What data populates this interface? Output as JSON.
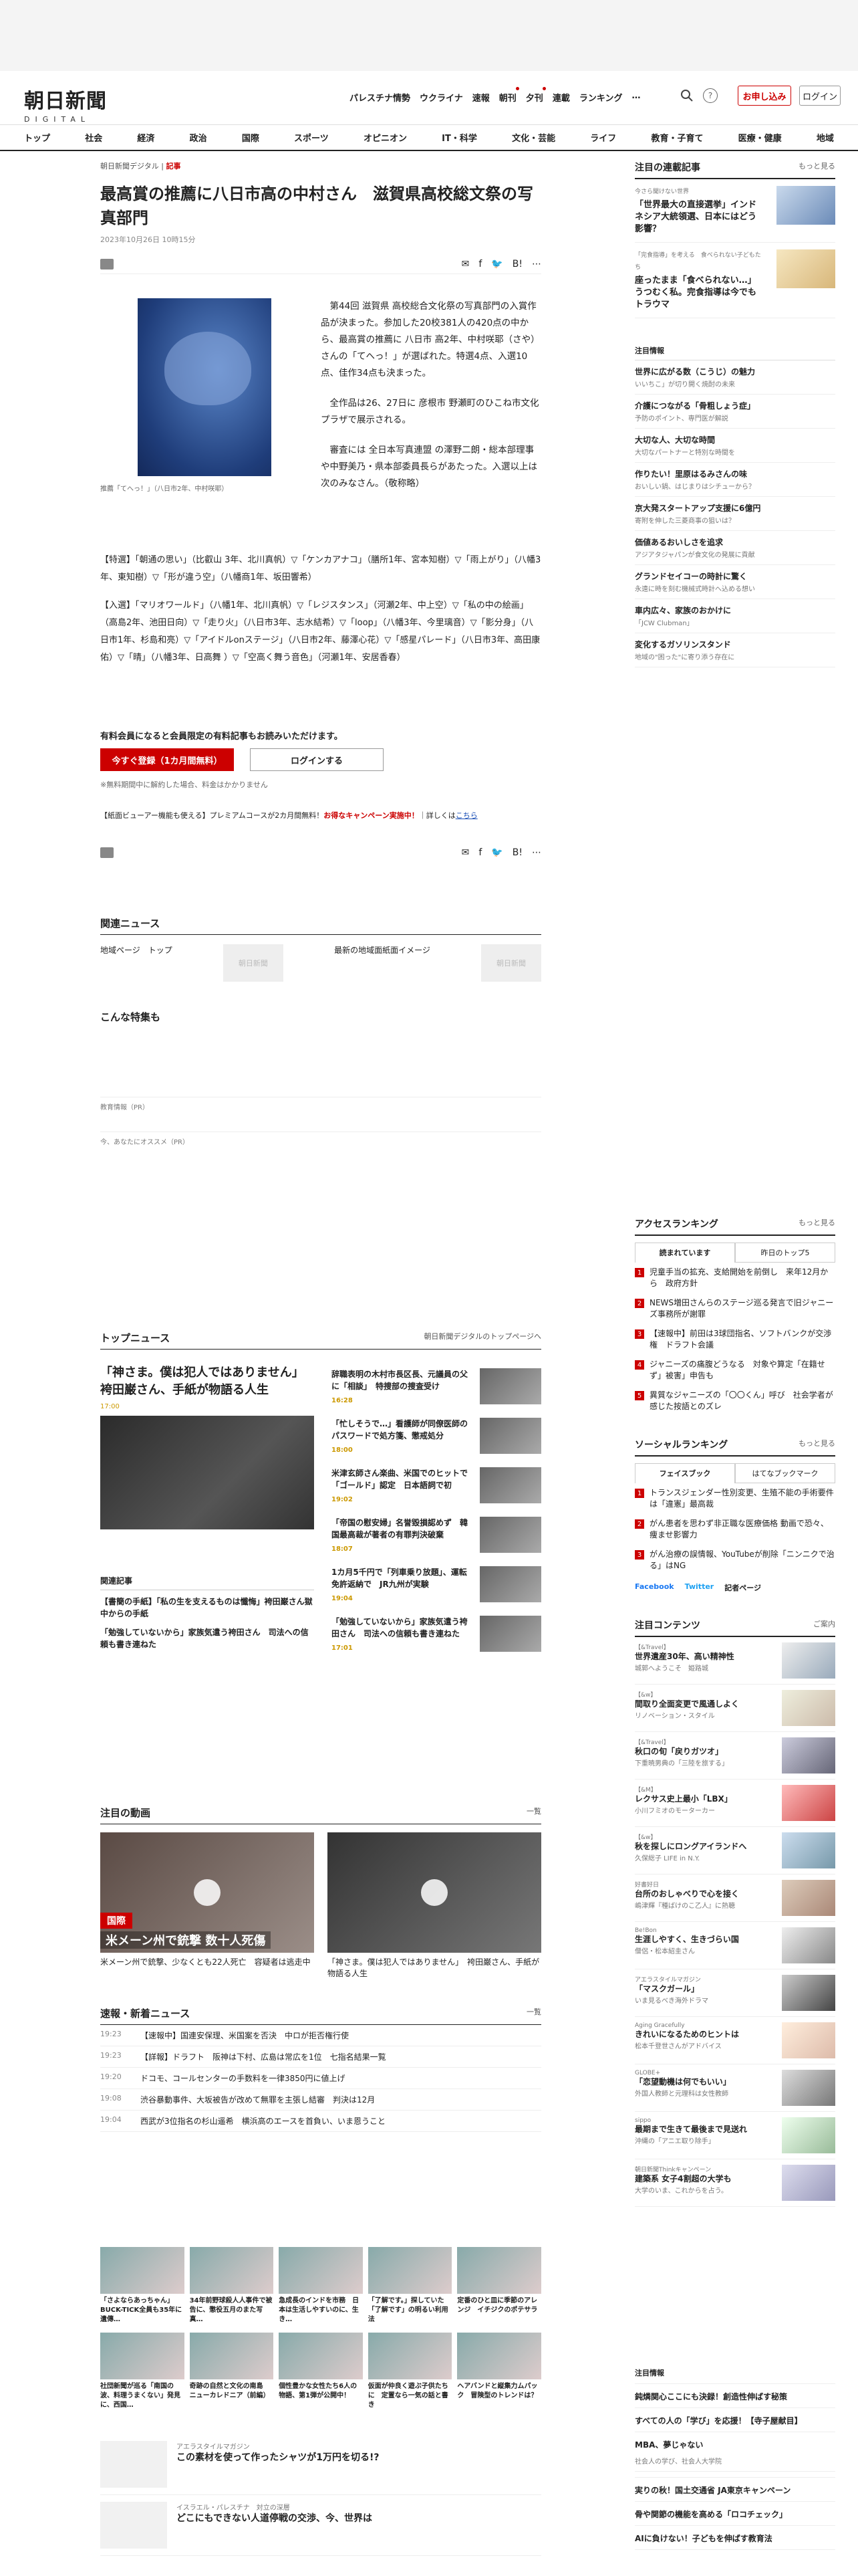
{
  "header": {
    "logo_jp": "朝日新聞",
    "logo_en": "DIGITAL",
    "nav": [
      "パレスチナ情勢",
      "ウクライナ",
      "速報",
      "朝刊",
      "夕刊",
      "連載",
      "ランキング",
      "…"
    ],
    "subscribe": "お申し込み",
    "login": "ログイン"
  },
  "global_nav": [
    "トップ",
    "社会",
    "経済",
    "政治",
    "国際",
    "スポーツ",
    "オピニオン",
    "IT・科学",
    "文化・芸能",
    "ライフ",
    "教育・子育て",
    "医療・健康",
    "地域"
  ],
  "article": {
    "breadcrumb": "朝日新聞デジタル",
    "breadcrumb_tag": "記事",
    "title": "最高賞の推薦に八日市高の中村さん　滋賀県高校総文祭の写真部門",
    "date": "2023年10月26日 10時15分",
    "list_label": "list",
    "caption": "推薦「てへっ！」（八日市2年、中村咲耶）",
    "para1": "第44回 滋賀県 高校総合文化祭の写真部門の入賞作品が決まった。参加した20校381人の420点の中から、最高賞の推薦に 八日市 高2年、中村咲耶（さや）さんの「てへっ！」が選ばれた。特選4点、入選10点、佳作34点も決まった。",
    "para2": "全作品は26、27日に 彦根市 野瀬町のひこね市文化プラザで展示される。",
    "para3": "審査には 全日本写真連盟 の澤野二朗・総本部理事や中野美乃・県本部委員長らがあたった。入選以上は次のみなさん。（敬称略）",
    "tokusen": "【特選】「朝通の思い」（比叡山 3年、北川真帆）▽「ケンカアナコ」（膳所1年、宮本知樹）▽「雨上がり」（八幡3年、東知樹）▽「形が違う空」（八幡商1年、坂田響希）",
    "nyusen": "【入選】「マリオワールド」（八幡1年、北川真帆）▽「レジスタンス」（河瀬2年、中上空）▽「私の中の絵画」（高島2年、池田日向）▽「走り火」（八日市3年、志水結希）▽「loop」（八幡3年、今里璃音）▽「影分身」（八日市1年、杉島和亮）▽「アイドルonステージ」（八日市2年、藤澤心花）▽「感星パレード」（八日市3年、高田康佑）▽「晴」（八幡3年、日高舞 ）▽「空高く舞う音色」（河瀬1年、安居香春）"
  },
  "paywall": {
    "lead": "有料会員になると会員限定の有料記事もお読みいただけます。",
    "register": "今すぐ登録（1カ月間無料）",
    "login": "ログインする",
    "note": "※無料期間中に解約した場合、料金はかかりません",
    "promo_pre": "【紙面ビューアー機能も使える】プレミアムコースが2カ月間無料！",
    "promo_red": "お得なキャンペーン実施中！",
    "promo_post": "詳しくは",
    "promo_link": "こちら"
  },
  "related": {
    "heading": "関連ニュース",
    "item1": "地域ページ　トップ",
    "item2": "最新の地域面紙面イメージ",
    "thumb_label": "朝日新聞"
  },
  "tokushu_heading": "こんな特集も",
  "pr": {
    "a": "教育情報（PR）",
    "b": "今、あなたにオススメ（PR）"
  },
  "sidebar": {
    "heading": "注目の連載記事",
    "more": "もっと見る",
    "items": [
      {
        "kicker": "今さら聞けない世界",
        "title": "「世界最大の直接選挙」インドネシア大統領選、日本にはどう影響？"
      },
      {
        "kicker": "「完食指導」を考える　食べられない子どもたち",
        "title": "座ったまま「食べられない…」うつむく私。完食指導は今でもトラウマ"
      }
    ],
    "pr_label": "注目情報",
    "pr_items": [
      {
        "t": "世界に広がる数（こうじ）の魅力",
        "s": "いいちこ」が切り開く焼酎の未来"
      },
      {
        "t": "介護につながる「骨粗しょう症」",
        "s": "予防のポイント、専門医が解説"
      },
      {
        "t": "大切な人、大切な時間",
        "s": "大切なパートナーと特別な時間を"
      },
      {
        "t": "作りたい！里原はるみさんの味",
        "s": "おいしい鍋、はじまりはシチューから？"
      },
      {
        "t": "京大発スタートアップ支援に6億円",
        "s": "寄附を伸した三菱商事の狙いは？"
      },
      {
        "t": "価値あるおいしさを追求",
        "s": "アジアタジャパンが食文化の発展に貢献"
      },
      {
        "t": "グランドセイコーの時計に驚く",
        "s": "永遠に時を刻む機械式時計へ込める想い"
      },
      {
        "t": "車内広々、家族のおかけに",
        "s": "「JCW Clubman」"
      },
      {
        "t": "変化するガソリンスタンド",
        "s": "地域の\"困った\"に寄り添う存在に"
      }
    ]
  },
  "ranking": {
    "heading": "アクセスランキング",
    "more": "もっと見る",
    "tab1": "読まれています",
    "tab2": "昨日のトップ5",
    "items": [
      "児童手当の拡充、支給開始を前倒し　来年12月から　政府方針",
      "NEWS増田さんらのステージ巡る発言で旧ジャニーズ事務所が謝罪",
      "【速報中】前田は3球団指名、ソフトバンクが交渉権　ドラフト会議",
      "ジャニーズの痛腹どうなる　対象や算定「在籍せず」被害」申告も",
      "異質なジャニーズの「〇〇くん」呼び　社会学者が感じた按語とのズレ"
    ]
  },
  "social": {
    "heading": "ソーシャルランキング",
    "more": "もっと見る",
    "tab1": "フェイスブック",
    "tab2": "はてなブックマーク",
    "items": [
      "トランスジェンダー性別変更、生殖不能の手術要件は「違憲」最高裁",
      "がん患者を思わず非正職な医療価格 動画で恐々、痩ませ影響力",
      "がん治療の誤情報、YouTubeが削除「ニンニクで治る」はNG"
    ],
    "sns": [
      "Facebook",
      "Twitter",
      "記者ページ"
    ]
  },
  "contents": {
    "heading": "注目コンテンツ",
    "more": "ご案内",
    "items": [
      {
        "k": "【&Travel】",
        "t": "世界遺産30年、高い精神性",
        "s": "城郭へようこそ　姫路城"
      },
      {
        "k": "【&w】",
        "t": "間取り全面変更で風通しよく",
        "s": "リノベーション・スタイル"
      },
      {
        "k": "【&Travel】",
        "t": "秋口の旬「戻りガツオ」",
        "s": "下重暁男典の「三陸を旅する」"
      },
      {
        "k": "【&M】",
        "t": "レクサス史上最小「LBX」",
        "s": "小川フミオのモーターカー"
      },
      {
        "k": "【&w】",
        "t": "秋を探しにロングアイランドへ",
        "s": "久保総子 LIFE in N.Y."
      },
      {
        "k": "好書好日",
        "t": "台所のおしゃべりで心を接く",
        "s": "嶋津輝『種ばけのこ乙人』に熱聴"
      },
      {
        "k": "Be!Bon",
        "t": "生涯しやすく、生きづらい国",
        "s": "僧侶・松本紹圭さん"
      },
      {
        "k": "アエラスタイルマガジン",
        "t": "「マスクガール」",
        "s": "いま見るべき海外ドラマ"
      },
      {
        "k": "Aging Gracefully",
        "t": "きれいになるためのヒントは",
        "s": "松本千登世さんがアドバイス"
      },
      {
        "k": "GLOBE+",
        "t": "「恋望動機は何でもいい」",
        "s": "外国人教師と元理科は女性教師"
      },
      {
        "k": "sippo",
        "t": "最期まで生きて最後まで見送れ",
        "s": "沖縄の「アニエ取り除手」"
      },
      {
        "k": "朝日新聞Thinkキャンペーン",
        "t": "建築系 女子4割超の大学も",
        "s": "大学のいま、これからを占う。"
      }
    ]
  },
  "topnews": {
    "heading": "トップニュース",
    "link": "朝日新聞デジタルのトップページへ",
    "main_title": "「神さま。僕は犯人ではありません」　袴田巌さん、手紙が物語る人生",
    "main_time": "17:00",
    "sub": [
      {
        "t": "辞職表明の木村市長区長、元議員の父に「相談」　特捜部の捜査受け",
        "tm": "16:28"
      },
      {
        "t": "「忙しそうで…」看護師が同僚医師のパスワードで処方箋、懲戒処分",
        "tm": "18:00"
      },
      {
        "t": "米津玄師さん楽曲、米国でのヒットで「ゴールド」認定　日本語詞で初",
        "tm": "19:02"
      },
      {
        "t": "「帝国の慰安婦」名誉毀損認めず　韓国最高裁が著者の有罪判決破棄",
        "tm": "18:07"
      },
      {
        "t": "1カ月5千円で「列車乗り放題」、運転免許返納で　JR九州が実験",
        "tm": "19:04"
      },
      {
        "t": "「勉強していないから」家族気遣う袴田さん　司法への信頼も書き連ねた",
        "tm": "17:01"
      }
    ],
    "kanren_heading": "関連記事",
    "kanren": [
      "【書簡の手紙】「私の生を支えるものは懺悔」袴田巌さん獄中からの手紙",
      "「勉強していないから」家族気遣う袴田さん　司法への信頼も書き連ねた"
    ]
  },
  "video": {
    "heading": "注目の動画",
    "more": "一覧",
    "v1": "米メーン州で銃撃、少なくとも22人死亡　容疑者は逃走中",
    "v2": "「神さま。僕は犯人ではありません」　袴田巌さん、手紙が物語る人生",
    "v1_overlay": "米メーン州で銃撃 数十人死傷",
    "v1_badge": "国際"
  },
  "sokuho": {
    "heading": "速報・新着ニュース",
    "more": "一覧",
    "items": [
      {
        "tm": "19:23",
        "t": "【速報中】国連安保理、米国案を否決　中ロが拒否権行使"
      },
      {
        "tm": "19:23",
        "t": "【詳報】ドラフト　阪神は下村、広島は常広を1位　七指名結果一覧"
      },
      {
        "tm": "19:20",
        "t": "ドコモ、コールセンターの手数料を一律3850円に値上げ"
      },
      {
        "tm": "19:08",
        "t": "渋谷暴動事件、大坂被告が改めて無罪を主張し結審　判決は12月"
      },
      {
        "tm": "19:04",
        "t": "西武が3位指名の杉山遥希　横浜高のエースを首負い、いま恩うこと"
      }
    ]
  },
  "grid": [
    "「さよならあっちゃん」BUCK-TICK全員も35年に遺傳…",
    "34年前野球殺人人事件で被告に、懲役五月のまた写真…",
    "急成長のインドを市務　日本は生活しやすいのに、生き…",
    "「了解です。」探していた「了解です」の明るい利用法",
    "定番のひと皿に季節のアレンジ　イチジクのポテサラ",
    "社団新聞が巡る「南国の波、料理うまくない」発見に、西国…",
    "奇跡の自然と文化の南島　ニューカレドニア（前編）",
    "個性豊かな女性たち6人の物語、第1弾が公開中！",
    "仮面が仲良く遊ぶ子供たちに　定置なら一気の話と書き",
    "ヘアバンドと縦集力ムパック　冒険型のトレンドは？"
  ],
  "promo": [
    {
      "k": "アエラスタイルマガジン",
      "t": "この素材を使って作ったシャツが1万円を切る!?"
    },
    {
      "k": "イスラエル・パレスチナ　対立の深層",
      "t": "どこにもできない人道停戦の交渉、今、世界は"
    }
  ],
  "pr_side": {
    "label": "注目情報",
    "items": [
      {
        "t": "鈍燐関心ここにも決録！創造性伸ばす秘策",
        "s": ""
      },
      {
        "t": "すべての人の「学び」を応援！【寺子屋献目】",
        "s": ""
      },
      {
        "t": "MBA、夢じゃない",
        "s": "社会人の学び、社会人大学院"
      },
      {
        "t": "実りの秋！国土交通省 JA東京キャンペーン",
        "s": ""
      },
      {
        "t": "骨や関節の機能を高める「ロコチェック」",
        "s": ""
      },
      {
        "t": "AIに負けない！子どもを伸ばす教育法",
        "s": ""
      }
    ]
  }
}
